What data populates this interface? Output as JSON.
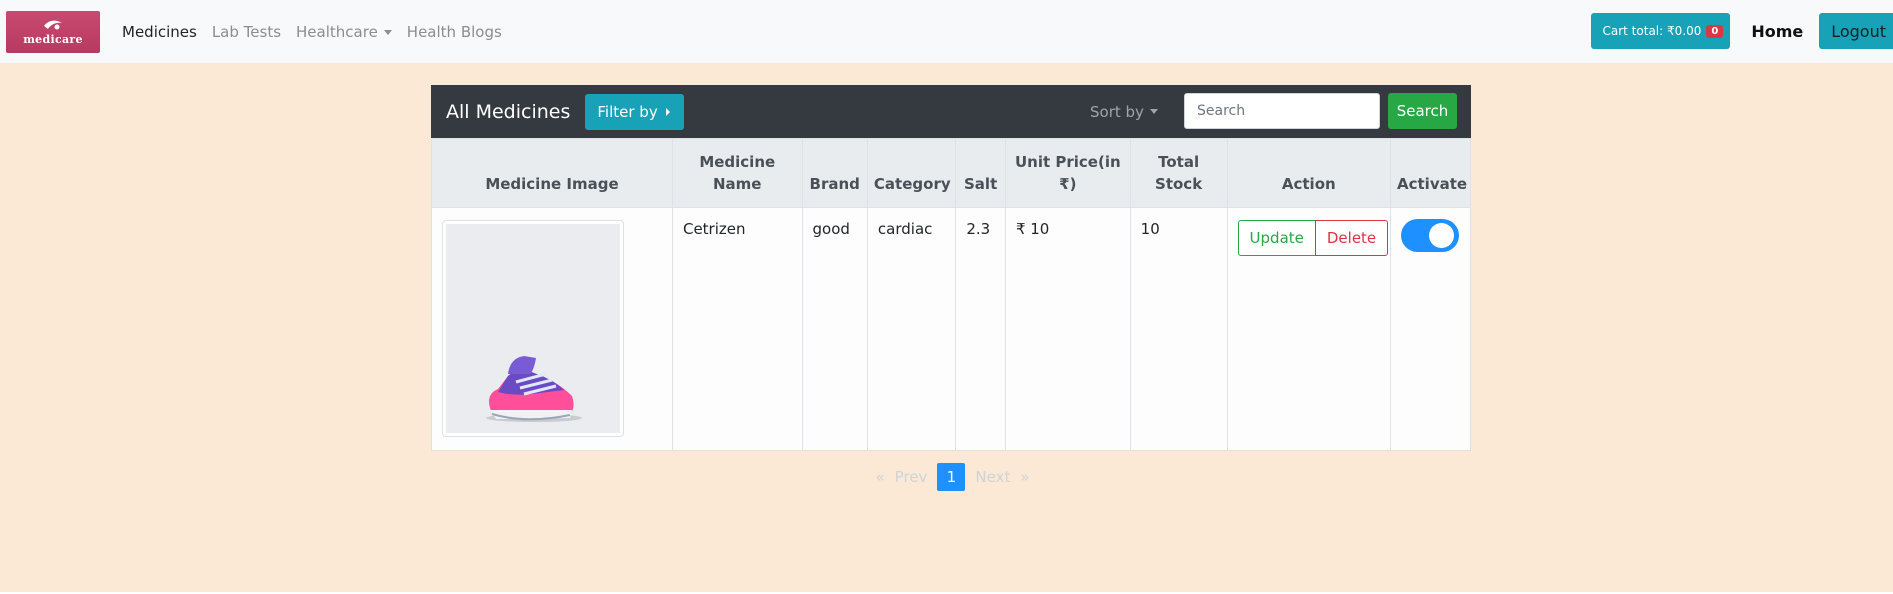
{
  "navbar": {
    "brand_text": "medicare",
    "links": [
      {
        "label": "Medicines"
      },
      {
        "label": "Lab Tests"
      },
      {
        "label": "Healthcare"
      },
      {
        "label": "Health Blogs"
      }
    ],
    "cart_label": "Cart total: ₹0.00",
    "cart_count": "0",
    "home_label": "Home",
    "logout_label": "Logout"
  },
  "card": {
    "title": "All Medicines",
    "filter_label": "Filter by",
    "sort_label": "Sort by",
    "search_placeholder": "Search",
    "search_button": "Search"
  },
  "table": {
    "headers": [
      "Medicine Image",
      "Medicine Name",
      "Brand",
      "Category",
      "Salt",
      "Unit Price(in ₹)",
      "Total Stock",
      "Action",
      "Activate"
    ],
    "rows": [
      {
        "name": "Cetrizen",
        "brand": "good",
        "category": "cardiac",
        "salt": "2.3",
        "price": "₹ 10",
        "stock": "10",
        "update_label": "Update",
        "delete_label": "Delete",
        "active": true
      }
    ]
  },
  "pagination": {
    "first": "«",
    "prev": "Prev",
    "current": "1",
    "next": "Next",
    "last": "»"
  },
  "colors": {
    "info": "#17a2b8",
    "success": "#28a745",
    "danger": "#dc3545",
    "toggle_on": "#1e90ff",
    "page_bg": "#fbe9d6",
    "header_dark": "#343a40"
  }
}
